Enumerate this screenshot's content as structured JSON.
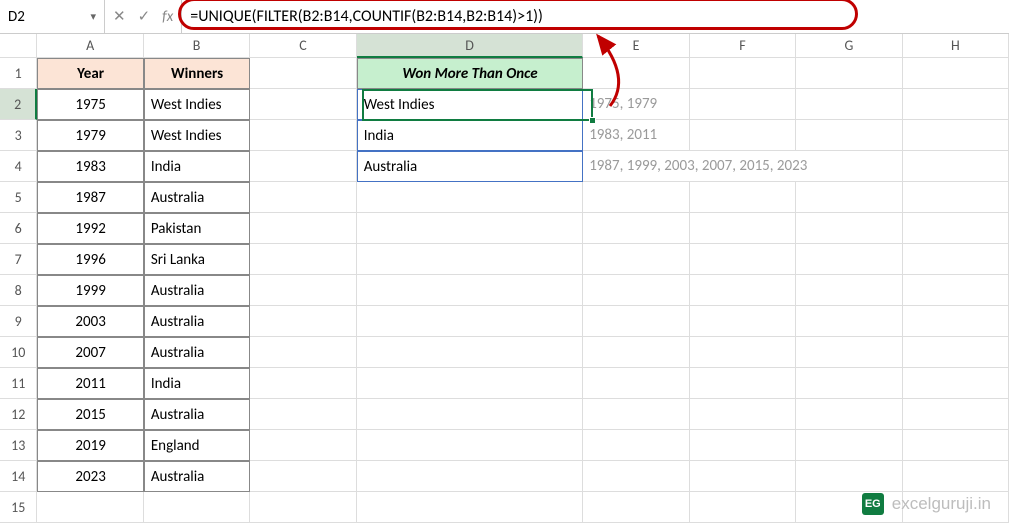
{
  "name_box": "D2",
  "formula": "=UNIQUE(FILTER(B2:B14,COUNTIF(B2:B14,B2:B14)>1))",
  "columns": [
    "A",
    "B",
    "C",
    "D",
    "E",
    "F",
    "G",
    "H"
  ],
  "table": {
    "header_a": "Year",
    "header_b": "Winners",
    "rows": [
      {
        "year": "1975",
        "winner": "West Indies"
      },
      {
        "year": "1979",
        "winner": "West Indies"
      },
      {
        "year": "1983",
        "winner": "India"
      },
      {
        "year": "1987",
        "winner": "Australia"
      },
      {
        "year": "1992",
        "winner": "Pakistan"
      },
      {
        "year": "1996",
        "winner": "Sri Lanka"
      },
      {
        "year": "1999",
        "winner": "Australia"
      },
      {
        "year": "2003",
        "winner": "Australia"
      },
      {
        "year": "2007",
        "winner": "Australia"
      },
      {
        "year": "2011",
        "winner": "India"
      },
      {
        "year": "2015",
        "winner": "Australia"
      },
      {
        "year": "2019",
        "winner": "England"
      },
      {
        "year": "2023",
        "winner": "Australia"
      }
    ]
  },
  "result": {
    "header": "Won More Than Once",
    "items": [
      {
        "country": "West Indies",
        "years": "1975, 1979"
      },
      {
        "country": "India",
        "years": "1983, 2011"
      },
      {
        "country": "Australia",
        "years": "1987, 1999, 2003, 2007, 2015, 2023"
      }
    ]
  },
  "watermark": "excelguruji.in",
  "wm_badge": "EG"
}
